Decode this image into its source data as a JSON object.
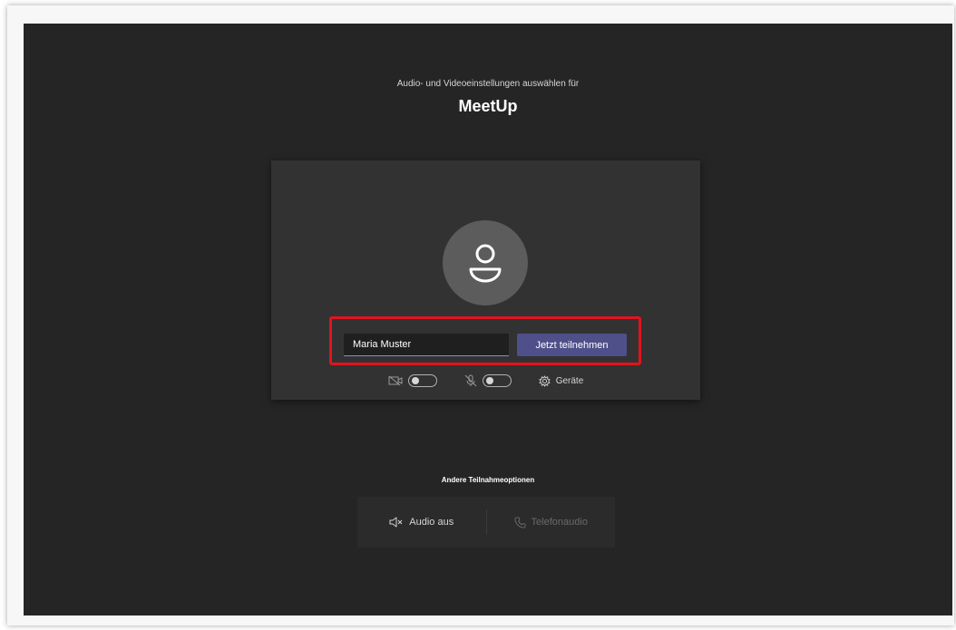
{
  "header": {
    "subtitle": "Audio- und Videoeinstellungen auswählen für",
    "meeting_title": "MeetUp"
  },
  "preview": {
    "name_input_value": "Maria Muster",
    "join_label": "Jetzt teilnehmen",
    "devices_label": "Geräte",
    "camera_on": false,
    "mic_on": false
  },
  "other": {
    "label": "Andere Teilnahmeoptionen",
    "audio_off_label": "Audio aus",
    "phone_audio_label": "Telefonaudio"
  },
  "colors": {
    "background": "#252525",
    "card": "#323232",
    "accent": "#4f4f8a",
    "highlight": "#e3131c"
  },
  "icons": [
    "avatar-person-icon",
    "camera-off-icon",
    "mic-off-icon",
    "gear-icon",
    "speaker-off-icon",
    "phone-icon"
  ]
}
